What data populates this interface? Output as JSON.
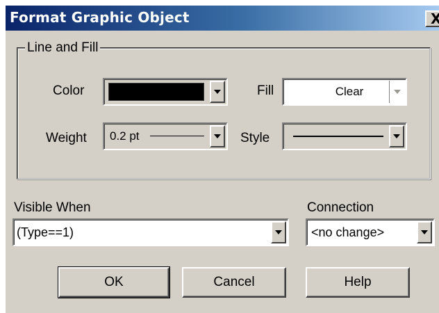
{
  "window": {
    "title": "Format Graphic Object",
    "close_glyph": "X"
  },
  "line_and_fill": {
    "group_label": "Line and Fill",
    "color": {
      "label": "Color",
      "value_color": "#000000"
    },
    "fill": {
      "label": "Fill",
      "value": "Clear"
    },
    "weight": {
      "label": "Weight",
      "value": "0.2 pt"
    },
    "style": {
      "label": "Style"
    }
  },
  "visible_when": {
    "label": "Visible When",
    "value": "(Type==1)"
  },
  "connection": {
    "label": "Connection",
    "value": "<no change>"
  },
  "buttons": {
    "ok": "OK",
    "cancel": "Cancel",
    "help": "Help"
  },
  "icons": {
    "close": "close-icon",
    "dropdown": "chevron-down-icon"
  }
}
